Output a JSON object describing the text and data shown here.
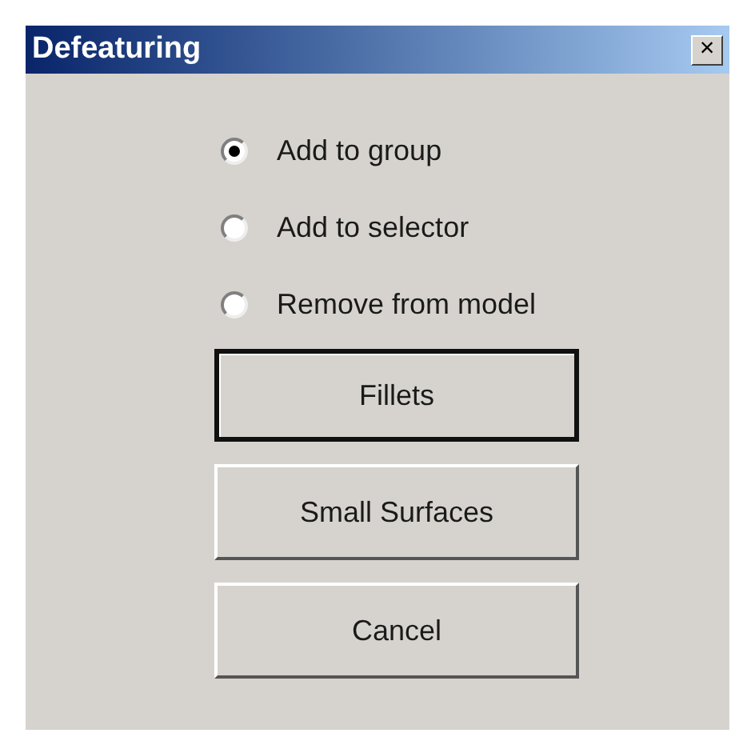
{
  "window": {
    "title": "Defeaturing",
    "close": "×"
  },
  "options": [
    {
      "label": "Add to group",
      "selected": true
    },
    {
      "label": "Add to selector",
      "selected": false
    },
    {
      "label": "Remove from model",
      "selected": false
    }
  ],
  "buttons": [
    {
      "label": "Fillets",
      "default": true
    },
    {
      "label": "Small Surfaces",
      "default": false
    },
    {
      "label": "Cancel",
      "default": false
    }
  ]
}
